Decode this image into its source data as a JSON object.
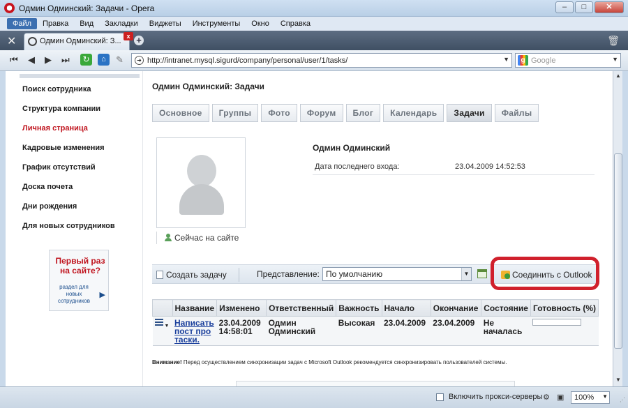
{
  "window": {
    "title": "Одмин Одминский: Задачи - Opera",
    "buttons": {
      "minimize": "–",
      "maximize": "□",
      "close": "✕"
    }
  },
  "menubar": {
    "items": [
      "Файл",
      "Правка",
      "Вид",
      "Закладки",
      "Виджеты",
      "Инструменты",
      "Окно",
      "Справка"
    ]
  },
  "tabbar": {
    "tab_title": "Одмин Одминский: З...",
    "tab_close": "x",
    "new_tab": "+"
  },
  "addressbar": {
    "url": "http://intranet.mysql.sigurd/company/personal/user/1/tasks/",
    "search_placeholder": "Google"
  },
  "sidebar": {
    "items": [
      {
        "label": "Поиск сотрудника"
      },
      {
        "label": "Структура компании"
      },
      {
        "label": "Личная страница"
      },
      {
        "label": "Кадровые изменения"
      },
      {
        "label": "График отсутствий"
      },
      {
        "label": "Доска почета"
      },
      {
        "label": "Дни рождения"
      },
      {
        "label": "Для новых сотрудников"
      }
    ],
    "promo": {
      "title": "Первый раз на сайте?",
      "subtitle": "раздел для новых сотрудников"
    }
  },
  "main": {
    "page_title": "Одмин Одминский: Задачи",
    "tabs": [
      "Основное",
      "Группы",
      "Фото",
      "Форум",
      "Блог",
      "Календарь",
      "Задачи",
      "Файлы"
    ],
    "active_tab": "Задачи",
    "profile": {
      "name": "Одмин Одминский",
      "last_login_label": "Дата последнего входа:",
      "last_login_value": "23.04.2009 14:52:53",
      "online_status": "Сейчас на сайте"
    },
    "toolbar": {
      "create_task": "Создать задачу",
      "view_label": "Представление:",
      "view_value": "По умолчанию",
      "outlook": "Соединить с Outlook"
    },
    "table": {
      "columns": [
        "Название",
        "Изменено",
        "Ответственный",
        "Важность",
        "Начало",
        "Окончание",
        "Состояние",
        "Готовность (%)"
      ],
      "rows": [
        {
          "name": "Написать пост про таски.",
          "modified": "23.04.2009 14:58:01",
          "responsible": "Одмин Одминский",
          "priority": "Высокая",
          "start": "23.04.2009",
          "end": "23.04.2009",
          "status": "Не началась",
          "progress": 0
        }
      ]
    },
    "notice_strong": "Внимание!",
    "notice_text": " Перед осуществлением синхронизации задач с Microsoft Outlook рекомендуется синхронизировать пользователей системы."
  },
  "statusbar": {
    "proxy_label": "Включить прокси-серверы",
    "zoom": "100%"
  },
  "colors": {
    "accent_red": "#c0141e",
    "link_blue": "#1a3f9c",
    "highlight": "#d0202c"
  }
}
